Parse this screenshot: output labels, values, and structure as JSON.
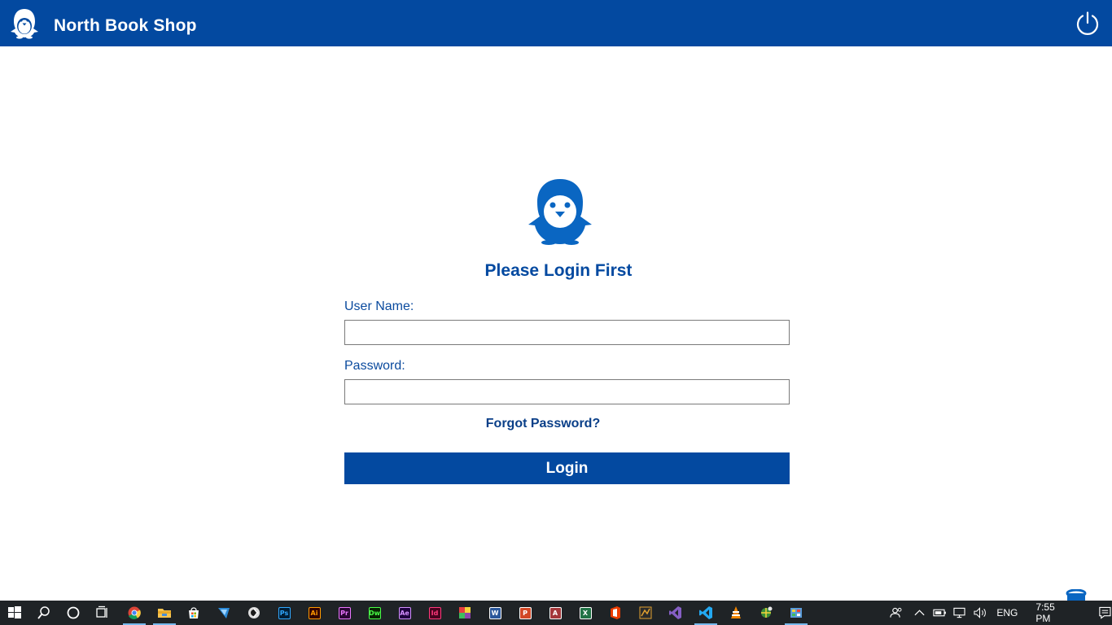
{
  "app": {
    "title": "North Book Shop",
    "colors": {
      "primary": "#0349a0",
      "label": "#0a4a9e",
      "logo": "#0a66c2"
    }
  },
  "login": {
    "heading": "Please Login First",
    "username_label": "User Name:",
    "username_value": "",
    "password_label": "Password:",
    "password_value": "",
    "forgot_label": "Forgot Password?",
    "login_label": "Login"
  },
  "taskbar": {
    "icons": [
      {
        "name": "windows-start-icon"
      },
      {
        "name": "search-icon"
      },
      {
        "name": "cortana-icon"
      },
      {
        "name": "task-view-icon"
      },
      {
        "name": "chrome-icon"
      },
      {
        "name": "file-explorer-icon"
      },
      {
        "name": "store-icon"
      },
      {
        "name": "sketchbook-icon"
      },
      {
        "name": "cinema-icon"
      },
      {
        "name": "photoshop-icon",
        "text": "Ps",
        "color": "#31a8ff",
        "bg": "#001e36"
      },
      {
        "name": "illustrator-icon",
        "text": "Ai",
        "color": "#ff9a00",
        "bg": "#330000"
      },
      {
        "name": "premiere-icon",
        "text": "Pr",
        "color": "#ea77ff",
        "bg": "#2a0634"
      },
      {
        "name": "dreamweaver-icon",
        "text": "Dw",
        "color": "#4aff49",
        "bg": "#072401"
      },
      {
        "name": "after-effects-icon",
        "text": "Ae",
        "color": "#d291ff",
        "bg": "#1f0040"
      },
      {
        "name": "indesign-icon",
        "text": "Id",
        "color": "#ff3a7c",
        "bg": "#49021f"
      },
      {
        "name": "color-app-icon"
      },
      {
        "name": "word-icon",
        "text": "W",
        "color": "#ffffff",
        "bg": "#2b579a"
      },
      {
        "name": "powerpoint-icon",
        "text": "P",
        "color": "#ffffff",
        "bg": "#d24726"
      },
      {
        "name": "access-icon",
        "text": "A",
        "color": "#ffffff",
        "bg": "#a4373a"
      },
      {
        "name": "excel-icon",
        "text": "X",
        "color": "#ffffff",
        "bg": "#217346"
      },
      {
        "name": "office-icon"
      },
      {
        "name": "media-app-icon"
      },
      {
        "name": "visual-studio-icon"
      },
      {
        "name": "vscode-icon"
      },
      {
        "name": "vlc-icon"
      },
      {
        "name": "network-tool-icon"
      },
      {
        "name": "control-panel-icon"
      }
    ],
    "language": "ENG",
    "time": "7:55 PM"
  }
}
